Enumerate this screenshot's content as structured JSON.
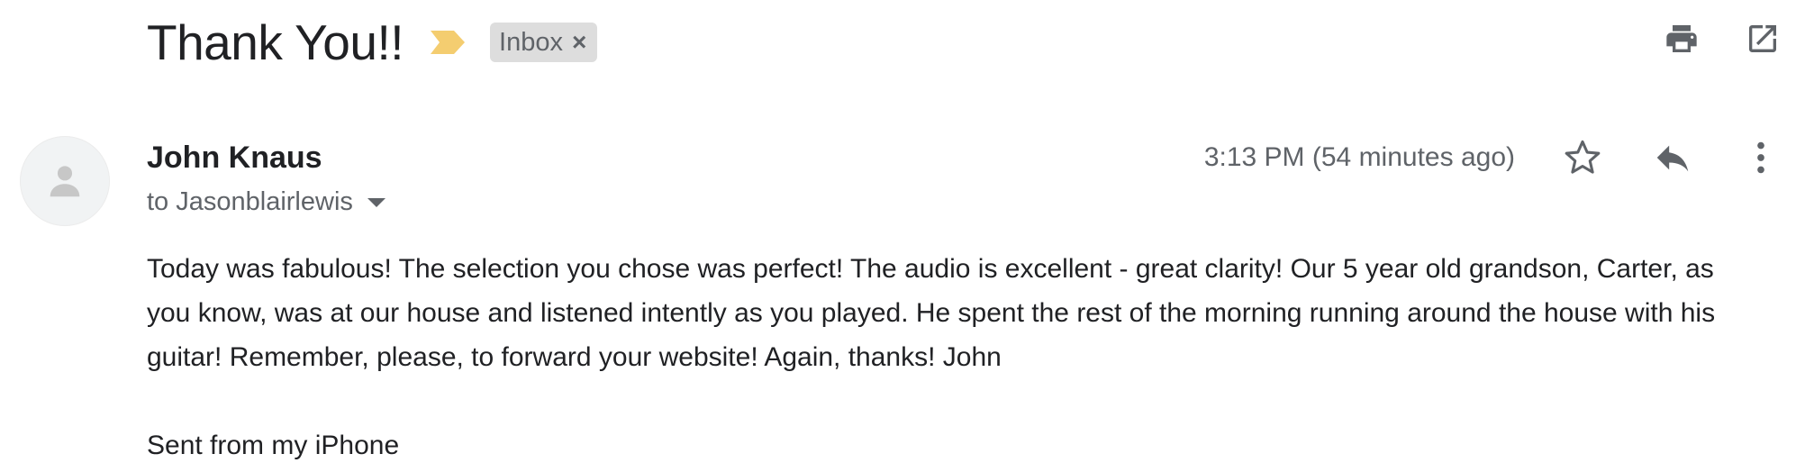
{
  "email": {
    "subject": "Thank You!!",
    "label": "Inbox",
    "label_remove_glyph": "×",
    "importance_color": "#f4cd70",
    "sender": "John Knaus",
    "recipient": "to Jasonblairlewis",
    "timestamp": "3:13 PM (54 minutes ago)",
    "body": "Today was fabulous! The selection you chose was perfect! The audio is excellent - great clarity! Our 5 year old grandson, Carter, as you know, was at our house and listened intently as you played. He spent the rest of the morning running around the house with his guitar! Remember, please, to forward your website! Again, thanks! John",
    "signature": "Sent from my iPhone"
  },
  "icons": {
    "print": "print-icon",
    "open_new_window": "open-in-new-window-icon",
    "importance": "importance-marker-icon",
    "avatar": "default-avatar-icon",
    "star": "star-icon",
    "reply": "reply-icon",
    "more": "more-vertical-icon",
    "recipient_details": "chevron-down-icon"
  }
}
